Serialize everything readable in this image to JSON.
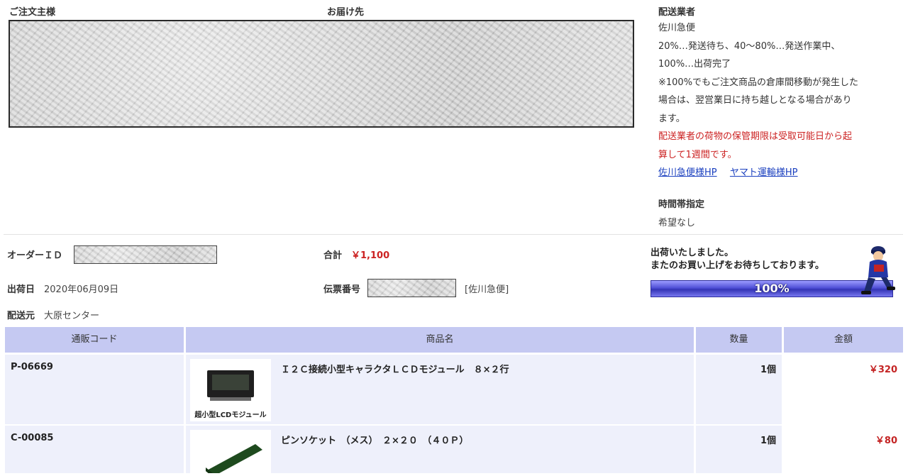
{
  "header": {
    "orderer_label": "ご注文主様",
    "delivery_to_label": "お届け先"
  },
  "carrier": {
    "heading": "配送業者",
    "name": "佐川急便",
    "line1": "20%…発送待ち、40～80%…発送作業中、",
    "line2": "100%…出荷完了",
    "line3": "※100%でもご注文商品の倉庫間移動が発生した",
    "line4": "場合は、翌営業日に持ち越しとなる場合があり",
    "line5": "ます。",
    "warn1": "配送業者の荷物の保管期限は受取可能日から起",
    "warn2": "算して1週間です。",
    "link_sagawa": "佐川急便様HP",
    "link_yamato": "ヤマト運輸様HP",
    "time_heading": "時間帯指定",
    "time_value": "希望なし"
  },
  "order": {
    "id_label": "オーダーＩＤ",
    "ship_date_label": "出荷日",
    "ship_date": "2020年06月09日",
    "origin_label": "配送元",
    "origin": "大原センター",
    "total_label": "合計",
    "total": "￥1,100",
    "slip_label": "伝票番号",
    "slip_carrier": "[佐川急便]"
  },
  "status": {
    "message1": "出荷いたしました。",
    "message2": "またのお買い上げをお待ちしております。",
    "progress_label": "100%",
    "progress_value": 1.0,
    "icon": "delivery-person-icon"
  },
  "table": {
    "headers": [
      "通販コード",
      "商品名",
      "数量",
      "金額"
    ],
    "rows": [
      {
        "code": "P-06669",
        "name": "Ｉ２Ｃ接続小型キャラクタＬＣＤモジュール　８×２行",
        "thumb_caption": "超小型LCDモジュール",
        "qty": "1個",
        "price": "￥320"
      },
      {
        "code": "C-00085",
        "name": "ピンソケット　（メス）　２×２０　（４０Ｐ）",
        "thumb_caption": "",
        "qty": "1個",
        "price": "￥80"
      }
    ]
  },
  "colors": {
    "accent_red": "#cc2222",
    "header_bg": "#c5c9f2",
    "row_bg": "#eef0fb",
    "link": "#1a3fbf",
    "progress": "#4f4fd6"
  }
}
